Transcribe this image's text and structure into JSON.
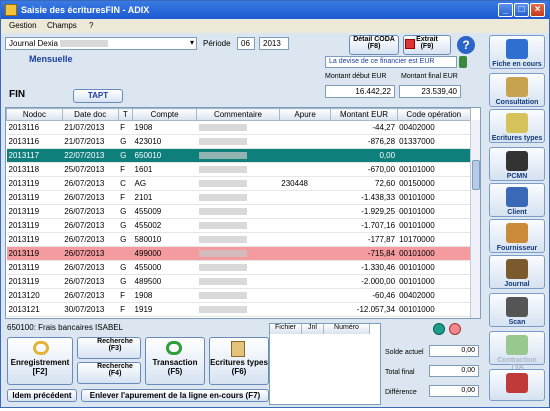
{
  "window": {
    "title": "Saisie des écrituresFIN  -  ADIX"
  },
  "menu": [
    "Gestion",
    "Champs",
    "?"
  ],
  "journal": {
    "label": "Journal Dexia",
    "subtitle": "Mensuelle",
    "code": "FIN"
  },
  "period": {
    "label": "Période",
    "month": "06",
    "year": "2013"
  },
  "buttons": {
    "detail_coda": "Détail CODA\n(F8)",
    "extrait": "Extrait\n(F9)",
    "tapt": "TAPT",
    "enregistrement": "Enregistrement\n[F2]",
    "recherche1": "Recherche\n(F3)",
    "recherche2": "Recherche\n(F4)",
    "transaction": "Transaction\n(F5)",
    "ecritures_types": "Ecritures types\n(F6)",
    "idem": "Idem précédent",
    "enlever": "Enlever l'apurement de la ligne en-cours (F7)"
  },
  "notice": "La devise de ce financier est EUR",
  "amounts": {
    "debut_label": "Montant début EUR",
    "debut_value": "16.442,22",
    "final_label": "Montant final EUR",
    "final_value": "23.539,40"
  },
  "grid": {
    "headers": [
      "Nodoc",
      "Date doc",
      "T",
      "Compte",
      "Commentaire",
      "Apure",
      "Montant EUR",
      "Code opération"
    ],
    "rows": [
      {
        "nodoc": "2013116",
        "date": "21/07/2013",
        "t": "F",
        "compte": "1908",
        "apure": "",
        "montant": "-44,27",
        "code": "00402000",
        "style": ""
      },
      {
        "nodoc": "2013116",
        "date": "21/07/2013",
        "t": "G",
        "compte": "423010",
        "apure": "",
        "montant": "-876,28",
        "code": "01337000",
        "style": ""
      },
      {
        "nodoc": "2013117",
        "date": "22/07/2013",
        "t": "G",
        "compte": "650010",
        "apure": "",
        "montant": "0,00",
        "code": "",
        "style": "selected"
      },
      {
        "nodoc": "2013118",
        "date": "25/07/2013",
        "t": "F",
        "compte": "1601",
        "apure": "",
        "montant": "-670,00",
        "code": "00101000",
        "style": ""
      },
      {
        "nodoc": "2013119",
        "date": "26/07/2013",
        "t": "C",
        "compte": "AG",
        "apure": "230448",
        "montant": "72,60",
        "code": "00150000",
        "style": ""
      },
      {
        "nodoc": "2013119",
        "date": "26/07/2013",
        "t": "F",
        "compte": "2101",
        "apure": "",
        "montant": "-1.438,33",
        "code": "00101000",
        "style": ""
      },
      {
        "nodoc": "2013119",
        "date": "26/07/2013",
        "t": "G",
        "compte": "455009",
        "apure": "",
        "montant": "-1.929,25",
        "code": "00101000",
        "style": ""
      },
      {
        "nodoc": "2013119",
        "date": "26/07/2013",
        "t": "G",
        "compte": "455002",
        "apure": "",
        "montant": "-1.707,16",
        "code": "00101000",
        "style": ""
      },
      {
        "nodoc": "2013119",
        "date": "26/07/2013",
        "t": "G",
        "compte": "580010",
        "apure": "",
        "montant": "-177,87",
        "code": "10170000",
        "style": ""
      },
      {
        "nodoc": "2013119",
        "date": "26/07/2013",
        "t": "",
        "compte": "499000",
        "apure": "",
        "montant": "-715,84",
        "code": "00101000",
        "style": "pink"
      },
      {
        "nodoc": "2013119",
        "date": "26/07/2013",
        "t": "G",
        "compte": "455000",
        "apure": "",
        "montant": "-1.330,46",
        "code": "00101000",
        "style": ""
      },
      {
        "nodoc": "2013119",
        "date": "26/07/2013",
        "t": "G",
        "compte": "489500",
        "apure": "",
        "montant": "-2.000,00",
        "code": "00101000",
        "style": ""
      },
      {
        "nodoc": "2013120",
        "date": "26/07/2013",
        "t": "F",
        "compte": "1908",
        "apure": "",
        "montant": "-60,46",
        "code": "00402000",
        "style": ""
      },
      {
        "nodoc": "2013121",
        "date": "30/07/2013",
        "t": "F",
        "compte": "1919",
        "apure": "",
        "montant": "-12.057,34",
        "code": "00101000",
        "style": ""
      }
    ]
  },
  "status": "650100: Frais bancaires ISABEL",
  "mini_grid": {
    "headers": [
      "Fichier",
      "Jnl",
      "Numéro"
    ]
  },
  "totals": {
    "solde_label": "Solde actuel",
    "solde_value": "0,00",
    "total_label": "Total final",
    "total_value": "0,00",
    "diff_label": "Différence",
    "diff_value": "0,00"
  },
  "sidebar": [
    {
      "label": "Fiche en cours",
      "icon": "person-card-icon",
      "color": "#2f6fd0"
    },
    {
      "label": "Consultation",
      "icon": "book-icon",
      "color": "#c7a24f"
    },
    {
      "label": "Ecritures types",
      "icon": "documents-icon",
      "color": "#d6c25a"
    },
    {
      "label": "PCMN",
      "icon": "book-stack-icon",
      "color": "#333333"
    },
    {
      "label": "Client",
      "icon": "client-icon",
      "color": "#3a69b8"
    },
    {
      "label": "Fournisseur",
      "icon": "box-icon",
      "color": "#c98a3a"
    },
    {
      "label": "Journal",
      "icon": "journal-icon",
      "color": "#7b5a2e"
    },
    {
      "label": "Scan",
      "icon": "scanner-icon",
      "color": "#555555"
    },
    {
      "label": "Contraction TVA",
      "icon": "plus-icon",
      "color": "#98c88f"
    },
    {
      "label": "",
      "icon": "exit-icon",
      "color": "#c13a3a"
    }
  ]
}
